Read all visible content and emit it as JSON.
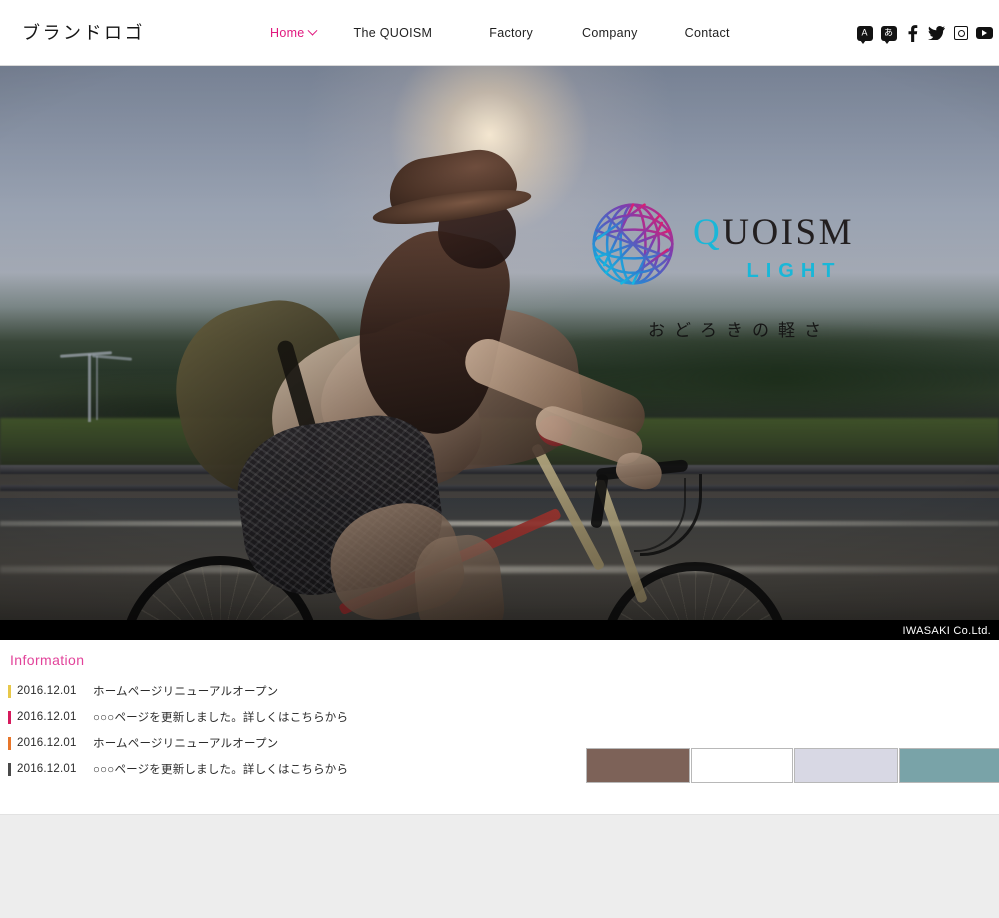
{
  "header": {
    "brand_logo": "ブランドロゴ",
    "nav": [
      {
        "label": "Home",
        "active": true,
        "has_dropdown": true
      },
      {
        "label": "The QUOISM",
        "active": false,
        "has_dropdown": false
      },
      {
        "label": "Factory",
        "active": false,
        "has_dropdown": false
      },
      {
        "label": "Company",
        "active": false,
        "has_dropdown": false
      },
      {
        "label": "Contact",
        "active": false,
        "has_dropdown": false
      }
    ],
    "social": [
      {
        "name": "language-en-icon",
        "glyph": "A"
      },
      {
        "name": "language-ja-icon",
        "glyph": "あ"
      },
      {
        "name": "facebook-icon",
        "glyph": "f"
      },
      {
        "name": "twitter-icon",
        "glyph": "🐦"
      },
      {
        "name": "instagram-icon",
        "glyph": ""
      },
      {
        "name": "youtube-icon",
        "glyph": ""
      }
    ],
    "active_color": "#e0187e"
  },
  "hero": {
    "alt": "Backlit photo of a woman in a sun hat riding a bicycle with a backpack along a road",
    "logo": {
      "brand": "QUOISM",
      "brand_first_letter": "Q",
      "brand_rest": "UOISM",
      "sub": "LIGHT",
      "tagline": "おどろきの軽さ",
      "globe_colors": [
        "#14b9e0",
        "#2f7fd0",
        "#7a3fb0",
        "#d81f72"
      ],
      "brand_color": "#231f20",
      "accent_color": "#19b7d8"
    },
    "credit": "IWASAKI Co.Ltd."
  },
  "information": {
    "title": "Information",
    "title_color": "#e2439a",
    "items": [
      {
        "date": "2016.12.01",
        "text": "ホームページリニューアルオープン",
        "bar_color": "#e8c84a"
      },
      {
        "date": "2016.12.01",
        "text": "○○○ページを更新しました。詳しくはこちらから",
        "bar_color": "#d61a5c"
      },
      {
        "date": "2016.12.01",
        "text": "ホームページリニューアルオープン",
        "bar_color": "#e8762a"
      },
      {
        "date": "2016.12.01",
        "text": "○○○ページを更新しました。詳しくはこちらから",
        "bar_color": "#4a4a4a"
      }
    ]
  },
  "swatches": [
    {
      "name": "swatch-brown",
      "color": "#7d6258"
    },
    {
      "name": "swatch-white",
      "color": "#ffffff"
    },
    {
      "name": "swatch-lavender",
      "color": "#d8d8e4"
    },
    {
      "name": "swatch-teal",
      "color": "#79a3a8"
    }
  ],
  "footer": {
    "background": "#ededed"
  }
}
